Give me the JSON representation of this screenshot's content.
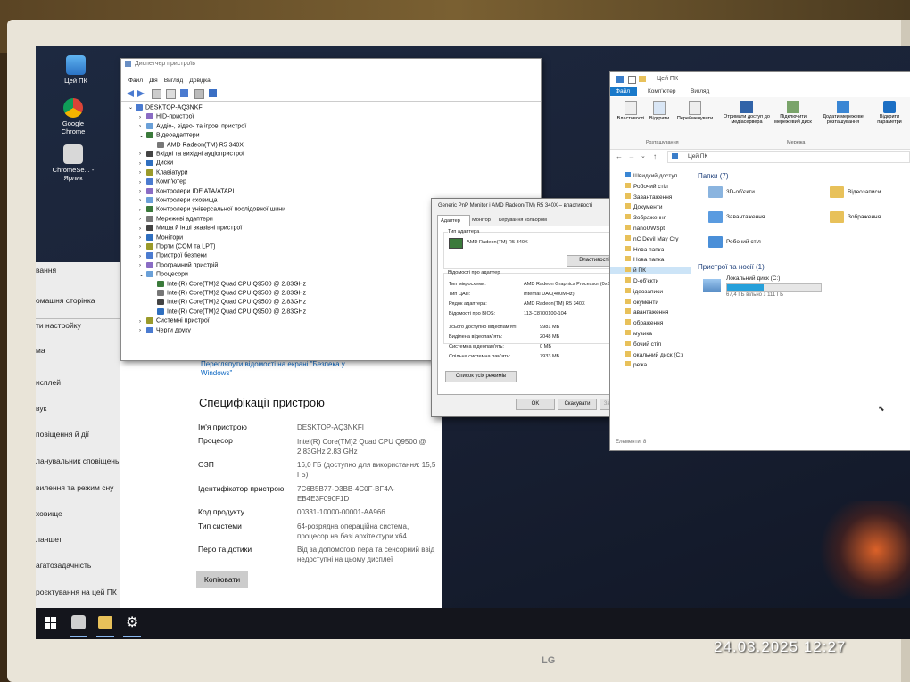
{
  "desktop": {
    "icons": [
      {
        "label": "Цей ПК"
      },
      {
        "label": "Google Chrome"
      },
      {
        "label": "ChromeSe... - Ярлик"
      }
    ]
  },
  "settings": {
    "nav": [
      "вання",
      "омашня сторінка",
      "ти настройку",
      "ма",
      "исплей",
      "вук",
      "повіщення й дії",
      "ланувальник сповіщень",
      "вилення та режим сну",
      "ховище",
      "ланшет",
      "агатозадачність",
      "роєктування на цей ПК"
    ],
    "link": "Перегляпути відомості на екрані \"Безпека у Windows\"",
    "spec_title": "Специфікації пристрою",
    "specs": [
      {
        "k": "Ім'я пристрою",
        "v": "DESKTOP-AQ3NKFI"
      },
      {
        "k": "Процесор",
        "v": "Intel(R) Core(TM)2 Quad CPU Q9500 @ 2.83GHz 2.83 GHz"
      },
      {
        "k": "ОЗП",
        "v": "16,0 ГБ (доступно для використання: 15,5 ГБ)"
      },
      {
        "k": "Ідентифікатор пристрою",
        "v": "7C6B5B77-D3BB-4C0F-BF4A-EB4E3F090F1D"
      },
      {
        "k": "Код продукту",
        "v": "00331-10000-00001-AA966"
      },
      {
        "k": "Тип системи",
        "v": "64-розрядна операційна система, процесор на базі архітектури x64"
      },
      {
        "k": "Перо та дотики",
        "v": "Від за допомогою пера та сенсорний ввід недоступні на цьому дисплеї"
      }
    ],
    "copy_button": "Копіювати"
  },
  "devmgr": {
    "title": "Диспетчер пристроїв",
    "menu": [
      "Файл",
      "Дія",
      "Вигляд",
      "Довідка"
    ],
    "tree": [
      {
        "t": "DESKTOP-AQ3NKFI",
        "lvl": 0
      },
      {
        "t": "HID-пристрої",
        "lvl": 1
      },
      {
        "t": "Аудіо-, відео- та ігрові пристрої",
        "lvl": 1
      },
      {
        "t": "Відеоадаптери",
        "lvl": 1
      },
      {
        "t": "AMD Radeon(TM) R5 340X",
        "lvl": 2
      },
      {
        "t": "Вхідні та вихідні аудіопристрої",
        "lvl": 1
      },
      {
        "t": "Диски",
        "lvl": 1
      },
      {
        "t": "Клавіатури",
        "lvl": 1
      },
      {
        "t": "Комп'ютер",
        "lvl": 1
      },
      {
        "t": "Контролери IDE ATA/ATAPI",
        "lvl": 1
      },
      {
        "t": "Контролери сховища",
        "lvl": 1
      },
      {
        "t": "Контролери універсальної послідовної шини",
        "lvl": 1
      },
      {
        "t": "Мережеві адаптери",
        "lvl": 1
      },
      {
        "t": "Миша й інші вказівні пристрої",
        "lvl": 1
      },
      {
        "t": "Монітори",
        "lvl": 1
      },
      {
        "t": "Порти (COM та LPT)",
        "lvl": 1
      },
      {
        "t": "Пристрої безпеки",
        "lvl": 1
      },
      {
        "t": "Програмний пристрій",
        "lvl": 1
      },
      {
        "t": "Процесори",
        "lvl": 1
      },
      {
        "t": "Intel(R) Core(TM)2 Quad CPU    Q9500  @ 2.83GHz",
        "lvl": 2
      },
      {
        "t": "Intel(R) Core(TM)2 Quad CPU    Q9500  @ 2.83GHz",
        "lvl": 2
      },
      {
        "t": "Intel(R) Core(TM)2 Quad CPU    Q9500  @ 2.83GHz",
        "lvl": 2
      },
      {
        "t": "Intel(R) Core(TM)2 Quad CPU    Q9500  @ 2.83GHz",
        "lvl": 2
      },
      {
        "t": "Системні пристрої",
        "lvl": 1
      },
      {
        "t": "Черги друку",
        "lvl": 1
      }
    ]
  },
  "props": {
    "title": "Generic PnP Monitor і AMD Radeon(TM) R5 340X – властивості",
    "tabs": [
      "Адаптер",
      "Монітор",
      "Керування кольором"
    ],
    "adapter_group": "Тип адаптера",
    "adapter_name": "AMD Radeon(TM) R5 340X",
    "properties_button": "Властивості",
    "info_group": "Відомості про адаптер",
    "info": [
      {
        "k": "Тип мікросхеми:",
        "v": "AMD Radeon Graphics Processor (0x6610)"
      },
      {
        "k": "Тип ЦАП:",
        "v": "Internal DAC(400MHz)"
      },
      {
        "k": "Рядок адаптера:",
        "v": "AMD Radeon(TM) R5 340X"
      },
      {
        "k": "Відомості про BIOS:",
        "v": "113-C8700100-104"
      }
    ],
    "memory": [
      {
        "k": "Усього доступно відеопам'яті:",
        "v": "9981 МБ"
      },
      {
        "k": "Виділена відеопам'ять:",
        "v": "2048 МБ"
      },
      {
        "k": "Системна відеопам'ять:",
        "v": "0 МБ"
      },
      {
        "k": "Спільна системна пам'ять:",
        "v": "7933 МБ"
      }
    ],
    "list_modes_button": "Список усіх режимів",
    "ok": "OK",
    "cancel": "Скасувати",
    "apply": "Застосувати"
  },
  "explorer": {
    "title": "Цей ПК",
    "tabs": [
      "Файл",
      "Комп'ютер",
      "Вигляд"
    ],
    "ribbon": [
      "Властивості",
      "Відкрити",
      "Перейменувати",
      "Отримати доступ до медіасервера",
      "Підключити мережевий диск",
      "Додати мережеве розташування",
      "Відкрити параметри"
    ],
    "ribbon_groups": [
      "Розташування",
      "Мережа"
    ],
    "path": "Цей ПК",
    "nav": [
      "Швидкий доступ",
      "Робочий стіл",
      "Завантаження",
      "Документи",
      "Зображення",
      "nanoUWSpt",
      "nC Devil May Cry",
      "Нова папка",
      "Нова папка",
      "й ПК",
      "D-об'єкти",
      "ідеозаписи",
      "окументи",
      "авантаження",
      "ображення",
      "музика",
      "бочий стіл",
      "окальний диск (C:)",
      "режа"
    ],
    "folders_header": "Папки (7)",
    "folders": [
      "3D-об'єкти",
      "Відеозаписи",
      "Завантаження",
      "Зображення",
      "Робочий стіл"
    ],
    "drives_header": "Пристрої та носії (1)",
    "drive_name": "Локальний диск (C:)",
    "drive_free": "67,4 ГБ вільно з 111 ГБ",
    "drive_used_fraction": 0.39,
    "status": "Елементи: 8"
  },
  "datetime": "24.03.2025   12:27",
  "brand": "LG"
}
